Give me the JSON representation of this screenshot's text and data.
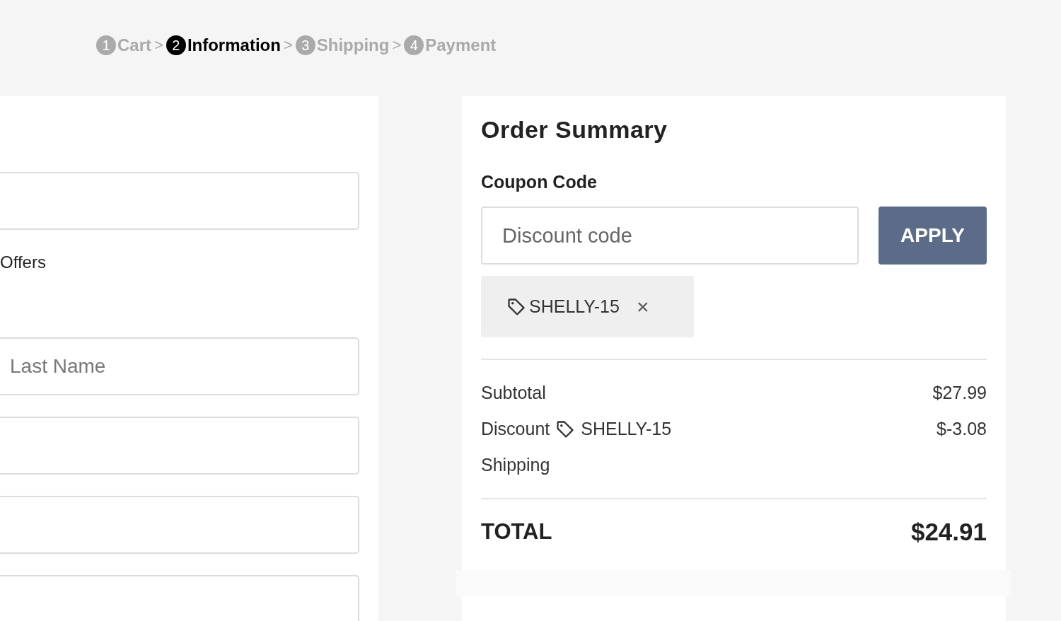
{
  "breadcrumb": [
    {
      "number": "1",
      "label": "Cart",
      "selected": false,
      "separator": ">"
    },
    {
      "number": "2",
      "label": "Information",
      "selected": true,
      "separator": ">"
    },
    {
      "number": "3",
      "label": "Shipping",
      "selected": false,
      "separator": ">"
    },
    {
      "number": "4",
      "label": "Payment",
      "selected": false
    }
  ],
  "form": {
    "fields_top": [
      {
        "kind": "text"
      }
    ],
    "offers_text": "Offers",
    "fields": [
      {
        "kind": "text",
        "placeholder": "Last Name"
      },
      {
        "kind": "text"
      },
      {
        "kind": "text"
      },
      {
        "kind": "text"
      }
    ]
  },
  "order_summary": {
    "title": "Order Summary",
    "coupon_label": "Coupon Code",
    "coupon_field": {
      "placeholder": "Discount code"
    },
    "apply_button": "APPLY",
    "applied_coupons": [
      {
        "code": "SHELLY-15",
        "remove": "×"
      }
    ],
    "lines": [
      {
        "label": "Subtotal",
        "value": "$27.99"
      },
      {
        "label": "Discount",
        "coupon": "SHELLY-15",
        "value": "$-3.08"
      },
      {
        "label": "Shipping"
      }
    ],
    "total_label": "TOTAL",
    "total_value": "$24.91"
  }
}
